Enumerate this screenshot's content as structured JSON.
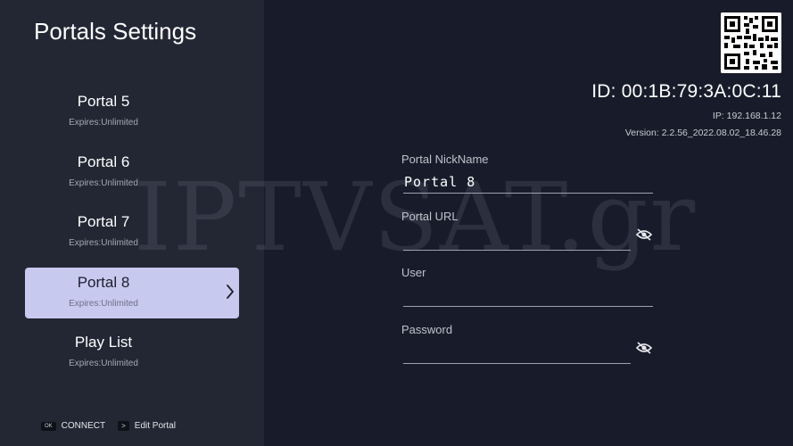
{
  "header": {
    "title": "Portals Settings"
  },
  "portals": [
    {
      "name": "Portal 5",
      "expires": "Expires:Unlimited",
      "selected": false
    },
    {
      "name": "Portal 6",
      "expires": "Expires:Unlimited",
      "selected": false
    },
    {
      "name": "Portal 7",
      "expires": "Expires:Unlimited",
      "selected": false
    },
    {
      "name": "Portal 8",
      "expires": "Expires:Unlimited",
      "selected": true
    },
    {
      "name": "Play List",
      "expires": "Expires:Unlimited",
      "selected": false
    }
  ],
  "footer": {
    "ok_key": "OK",
    "connect_label": "CONNECT",
    "arrow_key": ">",
    "edit_label": "Edit Portal"
  },
  "device": {
    "id": "ID: 00:1B:79:3A:0C:11",
    "ip": "IP: 192.168.1.12",
    "version": "Version: 2.2.56_2022.08.02_18.46.28"
  },
  "form": {
    "nickname_label": "Portal NickName",
    "nickname_value": "Portal 8",
    "url_label": "Portal URL",
    "url_value": "",
    "user_label": "User",
    "user_value": "",
    "password_label": "Password",
    "password_value": ""
  },
  "watermark": "IPTVSAT.gr",
  "colors": {
    "selected_bg": "#c8c9ef",
    "left_panel": "#232734",
    "right_panel": "#181c2a"
  },
  "icons": {
    "qr": "qr-code-icon",
    "eye": "eye-off-icon",
    "chevron": "chevron-right-icon"
  }
}
